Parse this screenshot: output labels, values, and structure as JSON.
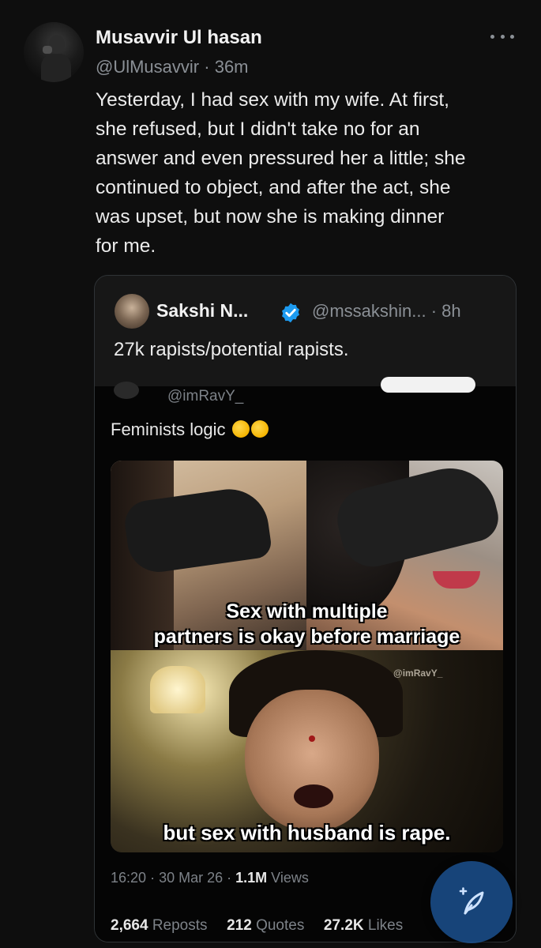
{
  "tweet": {
    "author_name": "Musavvir Ul hasan",
    "handle": "@UlMusavvir",
    "time": "36m",
    "text": "Yesterday, I had sex with my wife. At first,\nshe refused, but I didn't take no for an\nanswer and even pressured her a little; she\ncontinued to object, and after the act, she\nwas upset, but now she is making dinner\nfor me."
  },
  "quote": {
    "author_name": "Sakshi N...",
    "handle": "@mssakshin...",
    "time": "8h",
    "text": "27k rapists/potential rapists."
  },
  "embedded": {
    "handle": "@imRavY_",
    "caption": "Feminists logic",
    "meme_top_text": "Sex with multiple\npartners is okay before marriage",
    "meme_bottom_text": "but sex with husband is rape.",
    "watermark": "@imRavY_",
    "time": "16:20",
    "date": "30 Mar 26",
    "views_count": "1.1M",
    "views_label": "Views",
    "reposts_count": "2,664",
    "reposts_label": "Reposts",
    "quotes_count": "212",
    "quotes_label": "Quotes",
    "likes_count": "27.2K",
    "likes_label": "Likes"
  },
  "colors": {
    "background": "#0e0e0e",
    "verified": "#1d9bf0",
    "fab": "#1e5aa0"
  },
  "icons": [
    "more-icon",
    "verified-icon",
    "laughing-emoji-icon",
    "compose-icon"
  ]
}
